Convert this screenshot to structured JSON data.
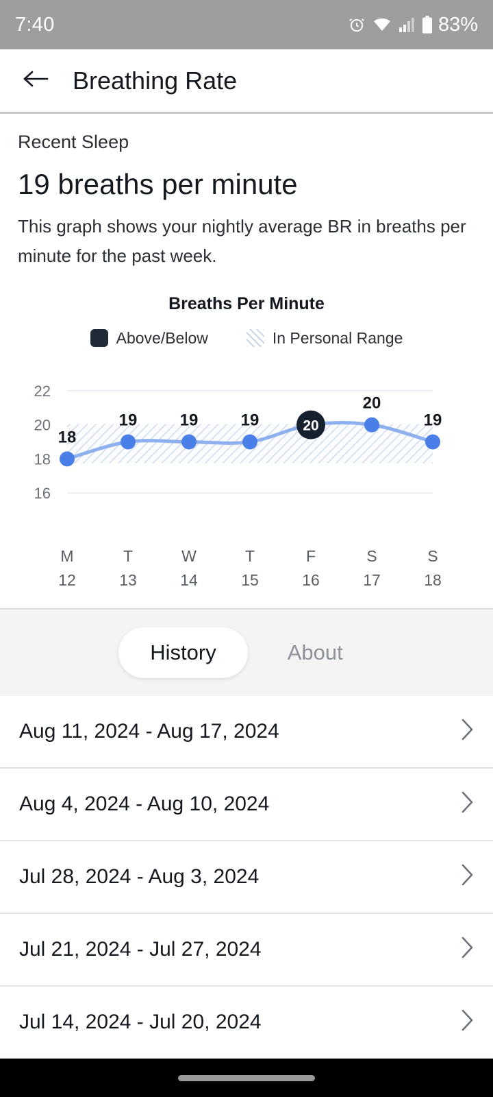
{
  "status_bar": {
    "time": "7:40",
    "battery_percent": "83%",
    "icons": [
      "alarm-icon",
      "wifi-icon",
      "cell-signal-icon",
      "battery-icon"
    ]
  },
  "app_bar": {
    "back_icon": "arrow-left-icon",
    "title": "Breathing Rate"
  },
  "summary": {
    "label": "Recent Sleep",
    "value": "19 breaths per minute",
    "description": "This graph shows your nightly average BR in breaths per minute for the past week."
  },
  "legend": {
    "above_below": "Above/Below",
    "in_range": "In Personal Range"
  },
  "tabs": [
    {
      "label": "History",
      "active": true
    },
    {
      "label": "About",
      "active": false
    }
  ],
  "history": {
    "rows": [
      {
        "label": "Aug 11, 2024 - Aug 17, 2024"
      },
      {
        "label": "Aug 4, 2024 - Aug 10, 2024"
      },
      {
        "label": "Jul 28, 2024 - Aug 3, 2024"
      },
      {
        "label": "Jul 21, 2024 - Jul 27, 2024"
      },
      {
        "label": "Jul 14, 2024 - Jul 20, 2024"
      }
    ],
    "chevron_icon": "chevron-right-icon"
  },
  "colors": {
    "point": "#4a7fe8",
    "line": "#8fb0ef",
    "selected_badge": "#16202e",
    "band_hatch": "#c8d4e8",
    "legend_solid": "#1f2a37",
    "status_bar": "#9e9e9e"
  },
  "chart_data": {
    "type": "line",
    "title": "Breaths Per Minute",
    "xlabel": "",
    "ylabel": "",
    "ylim": [
      15.2,
      22.6
    ],
    "yticks": [
      16,
      18,
      20,
      22
    ],
    "grid": true,
    "legend_position": "top",
    "categories": [
      "M 12",
      "T 13",
      "W 14",
      "T 15",
      "F 16",
      "S 17",
      "S 18"
    ],
    "day_labels": [
      "M",
      "T",
      "W",
      "T",
      "F",
      "S",
      "S"
    ],
    "date_labels": [
      "12",
      "13",
      "14",
      "15",
      "16",
      "17",
      "18"
    ],
    "values": [
      18,
      19,
      19,
      19,
      20,
      20,
      19
    ],
    "point_labels": [
      "18",
      "19",
      "19",
      "19",
      "20",
      "20",
      "19"
    ],
    "selected_index": 4,
    "selected_label": "20",
    "personal_range": {
      "low": 17.75,
      "high": 20.05,
      "label": "In Personal Range"
    },
    "series": [
      {
        "name": "Breaths Per Minute",
        "values": [
          18,
          19,
          19,
          19,
          20,
          20,
          19
        ]
      }
    ]
  }
}
